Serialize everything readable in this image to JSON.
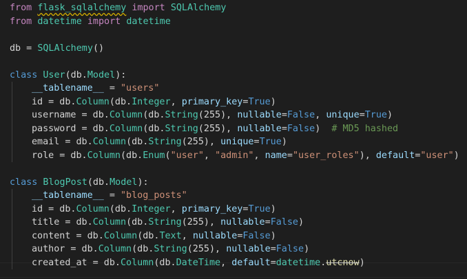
{
  "editor": {
    "lines": [
      [
        {
          "t": "from ",
          "c": "kw"
        },
        {
          "t": "flask_sqlalchemy",
          "c": "mod",
          "u": "squiggle"
        },
        {
          "t": " import ",
          "c": "kw"
        },
        {
          "t": "SQLAlchemy",
          "c": "cls"
        }
      ],
      [
        {
          "t": "from ",
          "c": "kw"
        },
        {
          "t": "datetime",
          "c": "mod"
        },
        {
          "t": " import ",
          "c": "kw"
        },
        {
          "t": "datetime",
          "c": "cls"
        }
      ],
      [],
      [
        {
          "t": "db = ",
          "c": "plain"
        },
        {
          "t": "SQLAlchemy",
          "c": "cls"
        },
        {
          "t": "()",
          "c": "plain"
        }
      ],
      [],
      [
        {
          "t": "class ",
          "c": "const"
        },
        {
          "t": "User",
          "c": "cls"
        },
        {
          "t": "(db.",
          "c": "plain"
        },
        {
          "t": "Model",
          "c": "cls"
        },
        {
          "t": "):",
          "c": "plain"
        }
      ],
      [
        {
          "t": "__tablename__",
          "c": "dunder"
        },
        {
          "t": " = ",
          "c": "plain"
        },
        {
          "t": "\"users\"",
          "c": "str"
        }
      ],
      [
        {
          "t": "id",
          "c": "plain"
        },
        {
          "t": " = db.",
          "c": "plain"
        },
        {
          "t": "Column",
          "c": "cls"
        },
        {
          "t": "(db.",
          "c": "plain"
        },
        {
          "t": "Integer",
          "c": "cls"
        },
        {
          "t": ", ",
          "c": "plain"
        },
        {
          "t": "primary_key",
          "c": "kwarg"
        },
        {
          "t": "=",
          "c": "plain"
        },
        {
          "t": "True",
          "c": "const"
        },
        {
          "t": ")",
          "c": "plain"
        }
      ],
      [
        {
          "t": "username",
          "c": "plain"
        },
        {
          "t": " = db.",
          "c": "plain"
        },
        {
          "t": "Column",
          "c": "cls"
        },
        {
          "t": "(db.",
          "c": "plain"
        },
        {
          "t": "String",
          "c": "cls"
        },
        {
          "t": "(255), ",
          "c": "plain"
        },
        {
          "t": "nullable",
          "c": "kwarg"
        },
        {
          "t": "=",
          "c": "plain"
        },
        {
          "t": "False",
          "c": "const"
        },
        {
          "t": ", ",
          "c": "plain"
        },
        {
          "t": "unique",
          "c": "kwarg"
        },
        {
          "t": "=",
          "c": "plain"
        },
        {
          "t": "True",
          "c": "const"
        },
        {
          "t": ")",
          "c": "plain"
        }
      ],
      [
        {
          "t": "password",
          "c": "plain"
        },
        {
          "t": " = db.",
          "c": "plain"
        },
        {
          "t": "Column",
          "c": "cls"
        },
        {
          "t": "(db.",
          "c": "plain"
        },
        {
          "t": "String",
          "c": "cls"
        },
        {
          "t": "(255), ",
          "c": "plain"
        },
        {
          "t": "nullable",
          "c": "kwarg"
        },
        {
          "t": "=",
          "c": "plain"
        },
        {
          "t": "False",
          "c": "const"
        },
        {
          "t": ")  ",
          "c": "plain"
        },
        {
          "t": "# MD5 hashed",
          "c": "cmt"
        }
      ],
      [
        {
          "t": "email",
          "c": "plain"
        },
        {
          "t": " = db.",
          "c": "plain"
        },
        {
          "t": "Column",
          "c": "cls"
        },
        {
          "t": "(db.",
          "c": "plain"
        },
        {
          "t": "String",
          "c": "cls"
        },
        {
          "t": "(255), ",
          "c": "plain"
        },
        {
          "t": "unique",
          "c": "kwarg"
        },
        {
          "t": "=",
          "c": "plain"
        },
        {
          "t": "True",
          "c": "const"
        },
        {
          "t": ")",
          "c": "plain"
        }
      ],
      [
        {
          "t": "role",
          "c": "plain"
        },
        {
          "t": " = db.",
          "c": "plain"
        },
        {
          "t": "Column",
          "c": "cls"
        },
        {
          "t": "(db.",
          "c": "plain"
        },
        {
          "t": "Enum",
          "c": "cls"
        },
        {
          "t": "(",
          "c": "plain"
        },
        {
          "t": "\"user\"",
          "c": "str"
        },
        {
          "t": ", ",
          "c": "plain"
        },
        {
          "t": "\"admin\"",
          "c": "str"
        },
        {
          "t": ", ",
          "c": "plain"
        },
        {
          "t": "name",
          "c": "kwarg"
        },
        {
          "t": "=",
          "c": "plain"
        },
        {
          "t": "\"user_roles\"",
          "c": "str"
        },
        {
          "t": "), ",
          "c": "plain"
        },
        {
          "t": "default",
          "c": "kwarg"
        },
        {
          "t": "=",
          "c": "plain"
        },
        {
          "t": "\"user\"",
          "c": "str"
        },
        {
          "t": ")",
          "c": "plain"
        }
      ],
      [],
      [
        {
          "t": "class ",
          "c": "const"
        },
        {
          "t": "BlogPost",
          "c": "cls"
        },
        {
          "t": "(db.",
          "c": "plain"
        },
        {
          "t": "Model",
          "c": "cls"
        },
        {
          "t": "):",
          "c": "plain"
        }
      ],
      [
        {
          "t": "__tablename__",
          "c": "dunder"
        },
        {
          "t": " = ",
          "c": "plain"
        },
        {
          "t": "\"blog_posts\"",
          "c": "str"
        }
      ],
      [
        {
          "t": "id",
          "c": "plain"
        },
        {
          "t": " = db.",
          "c": "plain"
        },
        {
          "t": "Column",
          "c": "cls"
        },
        {
          "t": "(db.",
          "c": "plain"
        },
        {
          "t": "Integer",
          "c": "cls"
        },
        {
          "t": ", ",
          "c": "plain"
        },
        {
          "t": "primary_key",
          "c": "kwarg"
        },
        {
          "t": "=",
          "c": "plain"
        },
        {
          "t": "True",
          "c": "const"
        },
        {
          "t": ")",
          "c": "plain"
        }
      ],
      [
        {
          "t": "title",
          "c": "plain"
        },
        {
          "t": " = db.",
          "c": "plain"
        },
        {
          "t": "Column",
          "c": "cls"
        },
        {
          "t": "(db.",
          "c": "plain"
        },
        {
          "t": "String",
          "c": "cls"
        },
        {
          "t": "(255), ",
          "c": "plain"
        },
        {
          "t": "nullable",
          "c": "kwarg"
        },
        {
          "t": "=",
          "c": "plain"
        },
        {
          "t": "False",
          "c": "const"
        },
        {
          "t": ")",
          "c": "plain"
        }
      ],
      [
        {
          "t": "content",
          "c": "plain"
        },
        {
          "t": " = db.",
          "c": "plain"
        },
        {
          "t": "Column",
          "c": "cls"
        },
        {
          "t": "(db.",
          "c": "plain"
        },
        {
          "t": "Text",
          "c": "cls"
        },
        {
          "t": ", ",
          "c": "plain"
        },
        {
          "t": "nullable",
          "c": "kwarg"
        },
        {
          "t": "=",
          "c": "plain"
        },
        {
          "t": "False",
          "c": "const"
        },
        {
          "t": ")",
          "c": "plain"
        }
      ],
      [
        {
          "t": "author",
          "c": "plain"
        },
        {
          "t": " = db.",
          "c": "plain"
        },
        {
          "t": "Column",
          "c": "cls"
        },
        {
          "t": "(db.",
          "c": "plain"
        },
        {
          "t": "String",
          "c": "cls"
        },
        {
          "t": "(255), ",
          "c": "plain"
        },
        {
          "t": "nullable",
          "c": "kwarg"
        },
        {
          "t": "=",
          "c": "plain"
        },
        {
          "t": "False",
          "c": "const"
        },
        {
          "t": ")",
          "c": "plain"
        }
      ],
      [
        {
          "t": "created_at",
          "c": "plain"
        },
        {
          "t": " = db.",
          "c": "plain"
        },
        {
          "t": "Column",
          "c": "cls"
        },
        {
          "t": "(db.",
          "c": "plain"
        },
        {
          "t": "DateTime",
          "c": "cls"
        },
        {
          "t": ", ",
          "c": "plain"
        },
        {
          "t": "default",
          "c": "kwarg"
        },
        {
          "t": "=",
          "c": "plain"
        },
        {
          "t": "datetime",
          "c": "cls"
        },
        {
          "t": ".",
          "c": "plain"
        },
        {
          "t": "utcnow",
          "c": "fn",
          "u": "strike"
        },
        {
          "t": ")",
          "c": "plain"
        }
      ]
    ],
    "indented_lines": [
      6,
      7,
      8,
      9,
      10,
      11,
      14,
      15,
      16,
      17,
      18,
      19
    ]
  }
}
